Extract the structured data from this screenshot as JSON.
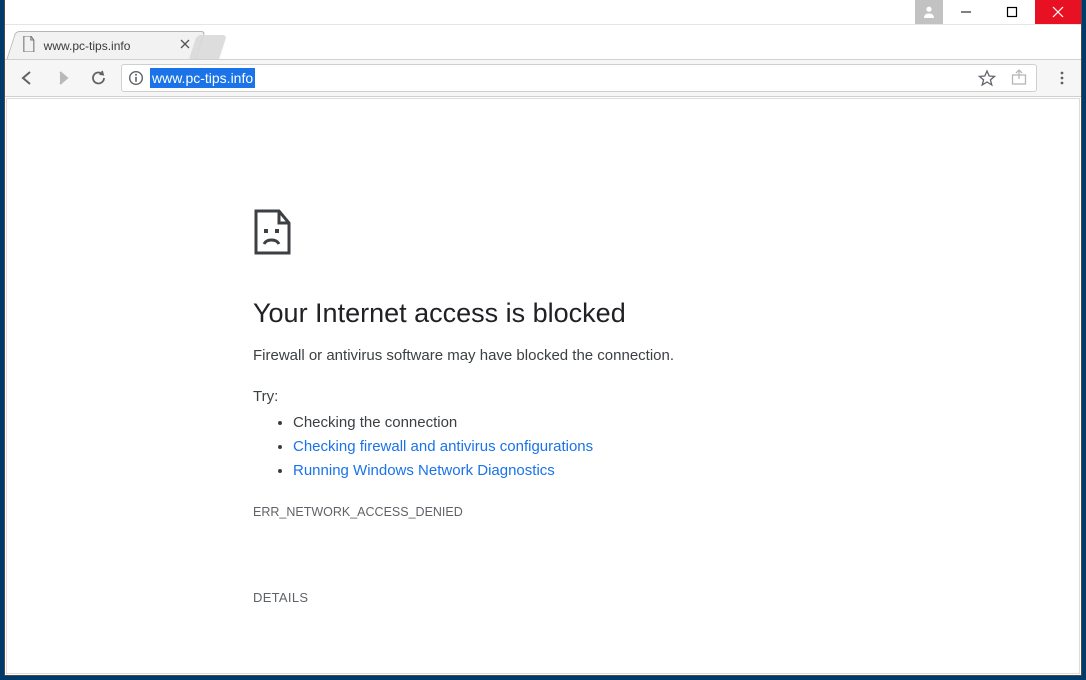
{
  "window": {
    "controls": {
      "user_icon": "user-icon",
      "minimize": "minimize",
      "maximize": "maximize",
      "close": "close"
    }
  },
  "tabs": [
    {
      "title": "www.pc-tips.info",
      "icon": "page"
    }
  ],
  "toolbar": {
    "back_enabled": true,
    "forward_enabled": false,
    "reload_enabled": true
  },
  "omnibox": {
    "security_icon": "info",
    "url": "www.pc-tips.info",
    "url_selected": true,
    "star_icon": "bookmark-star",
    "share_icon": "share"
  },
  "menu": {
    "icon": "kebab"
  },
  "error": {
    "title": "Your Internet access is blocked",
    "subtitle": "Firewall or antivirus software may have blocked the connection.",
    "try_label": "Try:",
    "suggestions": [
      {
        "text": "Checking the connection",
        "link": false
      },
      {
        "text": "Checking firewall and antivirus configurations",
        "link": true
      },
      {
        "text": "Running Windows Network Diagnostics",
        "link": true
      }
    ],
    "code": "ERR_NETWORK_ACCESS_DENIED",
    "details_label": "DETAILS"
  }
}
